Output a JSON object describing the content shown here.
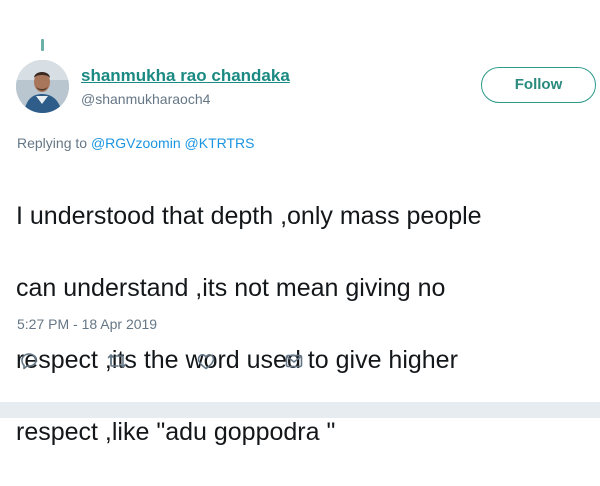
{
  "tweet": {
    "author": {
      "display_name": "shanmukha rao chandaka",
      "handle": "@shanmukharaoch4",
      "avatar_icon": "profile-photo"
    },
    "follow_label": "Follow",
    "replying_prefix": "Replying to ",
    "replying_to": [
      "@RGVzoomin",
      "@KTRTRS"
    ],
    "text_lines": [
      "I understood that depth ,only mass people",
      "can understand ,its not mean giving no",
      "respect ,its the word used to give higher",
      "respect ,like \"adu goppodra \""
    ],
    "timestamp": "5:27 PM - 18 Apr 2019",
    "actions": [
      "reply-icon",
      "retweet-icon",
      "like-icon",
      "direct-message-icon"
    ]
  },
  "colors": {
    "name_link": "#1b8a82",
    "follow_border": "#2d9a8c",
    "mention": "#1b95e0",
    "muted": "#657786",
    "divider": "#e6ecf0"
  }
}
